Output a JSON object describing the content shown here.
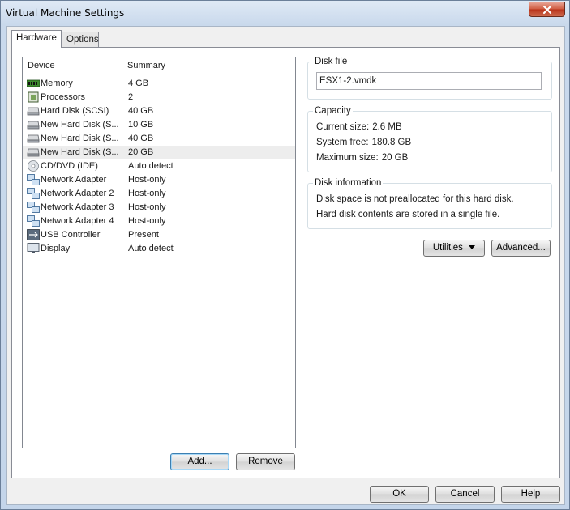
{
  "window": {
    "title": "Virtual Machine Settings"
  },
  "tabs": [
    {
      "label": "Hardware",
      "active": true
    },
    {
      "label": "Options",
      "active": false
    }
  ],
  "device_list": {
    "columns": [
      "Device",
      "Summary"
    ],
    "rows": [
      {
        "device": "Memory",
        "summary": "4 GB",
        "icon": "memory-icon"
      },
      {
        "device": "Processors",
        "summary": "2",
        "icon": "processor-icon"
      },
      {
        "device": "Hard Disk (SCSI)",
        "summary": "40 GB",
        "icon": "hard-disk-icon"
      },
      {
        "device": "New Hard Disk (S...",
        "summary": "10 GB",
        "icon": "hard-disk-icon"
      },
      {
        "device": "New Hard Disk (S...",
        "summary": "40 GB",
        "icon": "hard-disk-icon"
      },
      {
        "device": "New Hard Disk (S...",
        "summary": "20 GB",
        "icon": "hard-disk-icon",
        "selected": true
      },
      {
        "device": "CD/DVD (IDE)",
        "summary": "Auto detect",
        "icon": "cd-dvd-icon"
      },
      {
        "device": "Network Adapter",
        "summary": "Host-only",
        "icon": "network-adapter-icon"
      },
      {
        "device": "Network Adapter 2",
        "summary": "Host-only",
        "icon": "network-adapter-icon"
      },
      {
        "device": "Network Adapter 3",
        "summary": "Host-only",
        "icon": "network-adapter-icon"
      },
      {
        "device": "Network Adapter 4",
        "summary": "Host-only",
        "icon": "network-adapter-icon"
      },
      {
        "device": "USB Controller",
        "summary": "Present",
        "icon": "usb-icon"
      },
      {
        "device": "Display",
        "summary": "Auto detect",
        "icon": "display-icon"
      }
    ]
  },
  "list_buttons": {
    "add": "Add...",
    "remove": "Remove"
  },
  "disk_file": {
    "title": "Disk file",
    "value": "ESX1-2.vmdk"
  },
  "capacity": {
    "title": "Capacity",
    "current_label": "Current size:",
    "current_value": "2.6 MB",
    "free_label": "System free:",
    "free_value": "180.8 GB",
    "max_label": "Maximum size:",
    "max_value": "20 GB"
  },
  "disk_info": {
    "title": "Disk information",
    "line1": "Disk space is not preallocated for this hard disk.",
    "line2": "Hard disk contents are stored in a single file."
  },
  "panel_buttons": {
    "utilities": "Utilities",
    "advanced": "Advanced..."
  },
  "dialog_buttons": {
    "ok": "OK",
    "cancel": "Cancel",
    "help": "Help"
  }
}
